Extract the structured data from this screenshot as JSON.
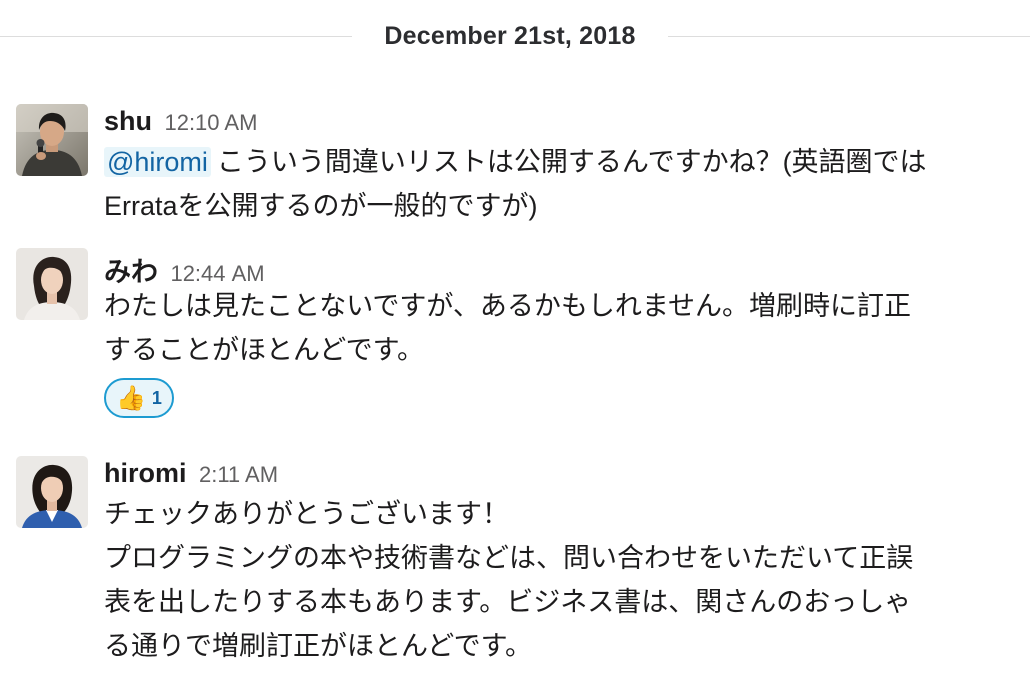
{
  "date_divider": "December 21st, 2018",
  "messages": [
    {
      "username": "shu",
      "time": "12:10 AM",
      "mention": "@hiromi",
      "text_line1": "こういう間違いリストは公開するんですかね？(英語圏では",
      "text_line2": "Errataを公開するのが一般的ですが)",
      "avatar": "shu-avatar"
    },
    {
      "username": "みわ",
      "time": "12:44 AM",
      "text": "わたしは見たことないですが、あるかもしれません。増刷時に訂正\nすることがほとんどです。",
      "reaction": {
        "emoji": "👍",
        "count": "1"
      },
      "avatar": "miwa-avatar"
    },
    {
      "username": "hiromi",
      "time": "2:11 AM",
      "text": "チェックありがとうございます！\nプログラミングの本や技術書などは、問い合わせをいただいて正誤\n表を出したりする本もあります。ビジネス書は、関さんのおっしゃ\nる通りで増刷訂正がほとんどです。",
      "avatar": "hiromi-avatar"
    }
  ],
  "colors": {
    "mention_bg": "#e8f5fa",
    "mention_text": "#1264a3",
    "reaction_border": "#1d9bd1",
    "divider": "#dddddd"
  }
}
